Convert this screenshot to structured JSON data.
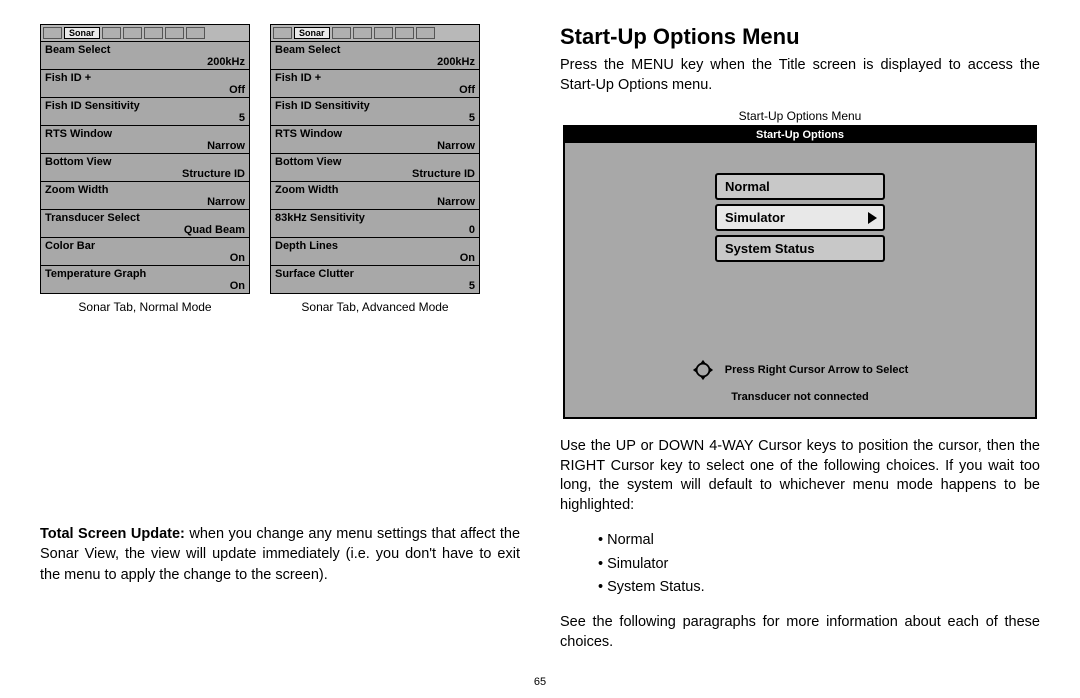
{
  "left": {
    "tab_label": "Sonar",
    "normal": {
      "caption": "Sonar Tab, Normal Mode",
      "rows": [
        {
          "label": "Beam Select",
          "value": "200kHz"
        },
        {
          "label": "Fish ID +",
          "value": "Off"
        },
        {
          "label": "Fish ID Sensitivity",
          "value": "5"
        },
        {
          "label": "RTS Window",
          "value": "Narrow"
        },
        {
          "label": "Bottom View",
          "value": "Structure ID"
        },
        {
          "label": "Zoom Width",
          "value": "Narrow"
        },
        {
          "label": "Transducer Select",
          "value": "Quad Beam"
        },
        {
          "label": "Color Bar",
          "value": "On"
        },
        {
          "label": "Temperature Graph",
          "value": "On"
        }
      ]
    },
    "advanced": {
      "caption": "Sonar Tab, Advanced Mode",
      "rows": [
        {
          "label": "Beam Select",
          "value": "200kHz"
        },
        {
          "label": "Fish ID +",
          "value": "Off"
        },
        {
          "label": "Fish ID Sensitivity",
          "value": "5"
        },
        {
          "label": "RTS Window",
          "value": "Narrow"
        },
        {
          "label": "Bottom View",
          "value": "Structure ID"
        },
        {
          "label": "Zoom Width",
          "value": "Narrow"
        },
        {
          "label": "83kHz Sensitivity",
          "value": "0"
        },
        {
          "label": "Depth Lines",
          "value": "On"
        },
        {
          "label": "Surface Clutter",
          "value": "5"
        }
      ]
    },
    "tsu_bold": "Total Screen Update:",
    "tsu_text": " when you change any menu settings that affect the Sonar View, the view will update immediately (i.e. you don't have to exit the menu to apply the change to the screen)."
  },
  "right": {
    "heading": "Start-Up Options Menu",
    "para1": "Press the MENU key when the Title screen is displayed to access the Start-Up Options menu.",
    "caption": "Start-Up Options Menu",
    "device": {
      "title": "Start-Up Options",
      "opts": [
        "Normal",
        "Simulator",
        "System Status"
      ],
      "selected": 1,
      "hint": "Press Right Cursor Arrow to Select",
      "status": "Transducer not connected"
    },
    "para2": "Use the UP or DOWN 4-WAY Cursor keys to position the cursor, then the RIGHT Cursor key to select one of the following choices. If you wait too long, the system will default to whichever menu mode happens to be highlighted:",
    "bullets": [
      "Normal",
      "Simulator",
      "System Status."
    ],
    "para3": "See the following paragraphs for more information about each of these choices."
  },
  "page_number": "65"
}
